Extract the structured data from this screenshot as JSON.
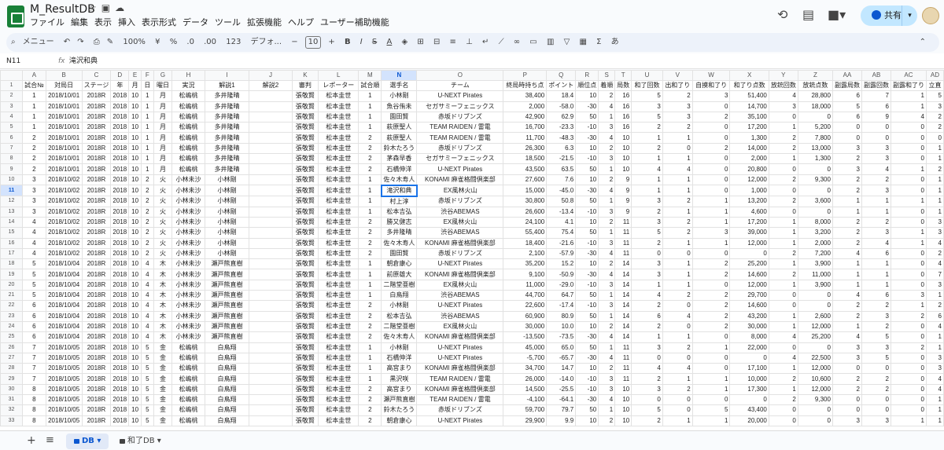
{
  "app": {
    "title": "M_ResultDB",
    "share": "共有"
  },
  "menu": [
    "ファイル",
    "編集",
    "表示",
    "挿入",
    "表示形式",
    "データ",
    "ツール",
    "拡張機能",
    "ヘルプ",
    "ユーザー補助機能"
  ],
  "toolbar": {
    "search": "メニュー",
    "zoom": "100%",
    "yen": "¥",
    "percent": "%",
    "dec_less": ".0",
    "dec_more": ".00",
    "numfmt": "123",
    "font": "デフォ...",
    "font_size": "10",
    "bold": "B",
    "italic": "I",
    "strike": "S",
    "sigma": "Σ",
    "ime": "あ"
  },
  "formula": {
    "cell": "N11",
    "fx": "fx",
    "value": "滝沢和典"
  },
  "columns": [
    "A",
    "B",
    "C",
    "D",
    "E",
    "F",
    "G",
    "H",
    "I",
    "J",
    "K",
    "L",
    "M",
    "N",
    "O",
    "P",
    "Q",
    "R",
    "S",
    "T",
    "U",
    "V",
    "W",
    "X",
    "Y",
    "Z",
    "AA",
    "AB",
    "AC",
    "AD"
  ],
  "headers": [
    "試合№",
    "対局日",
    "ステージ",
    "年",
    "月",
    "日",
    "曜日",
    "実況",
    "解説1",
    "解説2",
    "審判",
    "レポーター",
    "試合順",
    "選手名",
    "チーム",
    "終局時持ち点",
    "ポイント",
    "順位点",
    "着順",
    "局数",
    "和了回数",
    "出和了り",
    "自摸和了り",
    "和了り点数",
    "放銃回数",
    "放銃点数",
    "副露局数",
    "副露回数",
    "副露和了り",
    "立直"
  ],
  "rows": [
    {
      "n": "2",
      "c": [
        "1",
        "2018/10/01",
        "2018R",
        "2018",
        "10",
        "1",
        "月",
        "松嶋桃",
        "多井隆晴",
        "",
        "張敬賢",
        "松本圭世",
        "1",
        "小林剛",
        "U-NEXT Pirates",
        "38,400",
        "18.4",
        "10",
        "2",
        "16",
        "5",
        "2",
        "3",
        "51,400",
        "4",
        "28,800",
        "6",
        "7",
        "1",
        "5"
      ]
    },
    {
      "n": "3",
      "c": [
        "1",
        "2018/10/01",
        "2018R",
        "2018",
        "10",
        "1",
        "月",
        "松嶋桃",
        "多井隆晴",
        "",
        "張敬賢",
        "松本圭世",
        "1",
        "魚谷侑未",
        "セガサミーフェニックス",
        "2,000",
        "-58.0",
        "-30",
        "4",
        "16",
        "3",
        "3",
        "0",
        "14,700",
        "3",
        "18,000",
        "5",
        "6",
        "1",
        "3"
      ]
    },
    {
      "n": "4",
      "c": [
        "1",
        "2018/10/01",
        "2018R",
        "2018",
        "10",
        "1",
        "月",
        "松嶋桃",
        "多井隆晴",
        "",
        "張敬賢",
        "松本圭世",
        "1",
        "園田賢",
        "赤坂ドリブンズ",
        "42,900",
        "62.9",
        "50",
        "1",
        "16",
        "5",
        "3",
        "2",
        "35,100",
        "0",
        "0",
        "6",
        "9",
        "4",
        "2"
      ]
    },
    {
      "n": "5",
      "c": [
        "1",
        "2018/10/01",
        "2018R",
        "2018",
        "10",
        "1",
        "月",
        "松嶋桃",
        "多井隆晴",
        "",
        "張敬賢",
        "松本圭世",
        "1",
        "萩原聖人",
        "TEAM RAIDEN / 雷電",
        "16,700",
        "-23.3",
        "-10",
        "3",
        "16",
        "2",
        "2",
        "0",
        "17,200",
        "1",
        "5,200",
        "0",
        "0",
        "0",
        "2"
      ]
    },
    {
      "n": "6",
      "c": [
        "2",
        "2018/10/01",
        "2018R",
        "2018",
        "10",
        "1",
        "月",
        "松嶋桃",
        "多井隆晴",
        "",
        "張敬賢",
        "松本圭世",
        "2",
        "萩原聖人",
        "TEAM RAIDEN / 雷電",
        "11,700",
        "-48.3",
        "-30",
        "4",
        "10",
        "1",
        "1",
        "0",
        "1,300",
        "2",
        "7,800",
        "0",
        "0",
        "0",
        "0"
      ]
    },
    {
      "n": "7",
      "c": [
        "2",
        "2018/10/01",
        "2018R",
        "2018",
        "10",
        "1",
        "月",
        "松嶋桃",
        "多井隆晴",
        "",
        "張敬賢",
        "松本圭世",
        "2",
        "鈴木たろう",
        "赤坂ドリブンズ",
        "26,300",
        "6.3",
        "10",
        "2",
        "10",
        "2",
        "0",
        "2",
        "14,000",
        "2",
        "13,000",
        "3",
        "3",
        "0",
        "1"
      ]
    },
    {
      "n": "8",
      "c": [
        "2",
        "2018/10/01",
        "2018R",
        "2018",
        "10",
        "1",
        "月",
        "松嶋桃",
        "多井隆晴",
        "",
        "張敬賢",
        "松本圭世",
        "2",
        "茅森早香",
        "セガサミーフェニックス",
        "18,500",
        "-21.5",
        "-10",
        "3",
        "10",
        "1",
        "1",
        "0",
        "2,000",
        "1",
        "1,300",
        "2",
        "3",
        "0",
        "1"
      ]
    },
    {
      "n": "9",
      "c": [
        "2",
        "2018/10/01",
        "2018R",
        "2018",
        "10",
        "1",
        "月",
        "松嶋桃",
        "多井隆晴",
        "",
        "張敬賢",
        "松本圭世",
        "2",
        "石橋伸洋",
        "U-NEXT Pirates",
        "43,500",
        "63.5",
        "50",
        "1",
        "10",
        "4",
        "4",
        "0",
        "20,800",
        "0",
        "0",
        "3",
        "4",
        "1",
        "2"
      ]
    },
    {
      "n": "10",
      "c": [
        "3",
        "2018/10/02",
        "2018R",
        "2018",
        "10",
        "2",
        "火",
        "小林未沙",
        "小林剛",
        "",
        "張敬賢",
        "松本圭世",
        "1",
        "佐々木寿人",
        "KONAMI 麻雀格闘倶楽部",
        "27,600",
        "7.6",
        "10",
        "2",
        "9",
        "1",
        "1",
        "0",
        "12,000",
        "2",
        "9,300",
        "2",
        "2",
        "0",
        "1"
      ]
    },
    {
      "n": "11",
      "c": [
        "3",
        "2018/10/02",
        "2018R",
        "2018",
        "10",
        "2",
        "火",
        "小林未沙",
        "小林剛",
        "",
        "張敬賢",
        "松本圭世",
        "1",
        "滝沢和典",
        "EX風林火山",
        "15,000",
        "-45.0",
        "-30",
        "4",
        "9",
        "1",
        "1",
        "0",
        "1,000",
        "0",
        "0",
        "2",
        "3",
        "0",
        "1"
      ]
    },
    {
      "n": "12",
      "c": [
        "3",
        "2018/10/02",
        "2018R",
        "2018",
        "10",
        "2",
        "火",
        "小林未沙",
        "小林剛",
        "",
        "張敬賢",
        "松本圭世",
        "1",
        "村上淳",
        "赤坂ドリブンズ",
        "30,800",
        "50.8",
        "50",
        "1",
        "9",
        "3",
        "2",
        "1",
        "13,200",
        "2",
        "3,600",
        "1",
        "1",
        "1",
        "1"
      ]
    },
    {
      "n": "13",
      "c": [
        "3",
        "2018/10/02",
        "2018R",
        "2018",
        "10",
        "2",
        "火",
        "小林未沙",
        "小林剛",
        "",
        "張敬賢",
        "松本圭世",
        "1",
        "松本吉弘",
        "渋谷ABEMAS",
        "26,600",
        "-13.4",
        "-10",
        "3",
        "9",
        "2",
        "1",
        "1",
        "4,600",
        "0",
        "0",
        "1",
        "1",
        "0",
        "1"
      ]
    },
    {
      "n": "14",
      "c": [
        "4",
        "2018/10/02",
        "2018R",
        "2018",
        "10",
        "2",
        "火",
        "小林未沙",
        "小林剛",
        "",
        "張敬賢",
        "松本圭世",
        "2",
        "勝又健志",
        "EX風林火山",
        "24,100",
        "4.1",
        "10",
        "2",
        "11",
        "3",
        "2",
        "1",
        "17,200",
        "1",
        "8,000",
        "2",
        "2",
        "0",
        "3"
      ]
    },
    {
      "n": "15",
      "c": [
        "4",
        "2018/10/02",
        "2018R",
        "2018",
        "10",
        "2",
        "火",
        "小林未沙",
        "小林剛",
        "",
        "張敬賢",
        "松本圭世",
        "2",
        "多井隆晴",
        "渋谷ABEMAS",
        "55,400",
        "75.4",
        "50",
        "1",
        "11",
        "5",
        "2",
        "3",
        "39,000",
        "1",
        "3,200",
        "2",
        "3",
        "1",
        "3"
      ]
    },
    {
      "n": "16",
      "c": [
        "4",
        "2018/10/02",
        "2018R",
        "2018",
        "10",
        "2",
        "火",
        "小林未沙",
        "小林剛",
        "",
        "張敬賢",
        "松本圭世",
        "2",
        "佐々木寿人",
        "KONAMI 麻雀格闘倶楽部",
        "18,400",
        "-21.6",
        "-10",
        "3",
        "11",
        "2",
        "1",
        "1",
        "12,000",
        "1",
        "2,000",
        "2",
        "4",
        "1",
        "4"
      ]
    },
    {
      "n": "17",
      "c": [
        "4",
        "2018/10/02",
        "2018R",
        "2018",
        "10",
        "2",
        "火",
        "小林未沙",
        "小林剛",
        "",
        "張敬賢",
        "松本圭世",
        "2",
        "園田賢",
        "赤坂ドリブンズ",
        "2,100",
        "-57.9",
        "-30",
        "4",
        "11",
        "0",
        "0",
        "0",
        "0",
        "2",
        "7,200",
        "4",
        "6",
        "0",
        "2"
      ]
    },
    {
      "n": "18",
      "c": [
        "5",
        "2018/10/04",
        "2018R",
        "2018",
        "10",
        "4",
        "木",
        "小林未沙",
        "瀬戸熊直樹",
        "",
        "張敬賢",
        "松本圭世",
        "1",
        "朝倉康心",
        "U-NEXT Pirates",
        "35,200",
        "15.2",
        "10",
        "2",
        "14",
        "3",
        "1",
        "2",
        "25,200",
        "1",
        "3,900",
        "1",
        "1",
        "0",
        "4"
      ]
    },
    {
      "n": "19",
      "c": [
        "5",
        "2018/10/04",
        "2018R",
        "2018",
        "10",
        "4",
        "木",
        "小林未沙",
        "瀬戸熊直樹",
        "",
        "張敬賢",
        "松本圭世",
        "1",
        "前原雄大",
        "KONAMI 麻雀格闘倶楽部",
        "9,100",
        "-50.9",
        "-30",
        "4",
        "14",
        "3",
        "1",
        "2",
        "14,600",
        "2",
        "11,000",
        "1",
        "1",
        "0",
        "7"
      ]
    },
    {
      "n": "20",
      "c": [
        "5",
        "2018/10/04",
        "2018R",
        "2018",
        "10",
        "4",
        "木",
        "小林未沙",
        "瀬戸熊直樹",
        "",
        "張敬賢",
        "松本圭世",
        "1",
        "二階堂亜樹",
        "EX風林火山",
        "11,000",
        "-29.0",
        "-10",
        "3",
        "14",
        "1",
        "1",
        "0",
        "12,000",
        "1",
        "3,900",
        "1",
        "1",
        "0",
        "3"
      ]
    },
    {
      "n": "21",
      "c": [
        "5",
        "2018/10/04",
        "2018R",
        "2018",
        "10",
        "4",
        "木",
        "小林未沙",
        "瀬戸熊直樹",
        "",
        "張敬賢",
        "松本圭世",
        "1",
        "白鳥翔",
        "渋谷ABEMAS",
        "44,700",
        "64.7",
        "50",
        "1",
        "14",
        "4",
        "2",
        "2",
        "29,700",
        "0",
        "0",
        "4",
        "6",
        "3",
        "1"
      ]
    },
    {
      "n": "22",
      "c": [
        "6",
        "2018/10/04",
        "2018R",
        "2018",
        "10",
        "4",
        "木",
        "小林未沙",
        "瀬戸熊直樹",
        "",
        "張敬賢",
        "松本圭世",
        "2",
        "小林剛",
        "U-NEXT Pirates",
        "22,600",
        "-17.4",
        "-10",
        "3",
        "14",
        "2",
        "0",
        "2",
        "14,600",
        "0",
        "0",
        "2",
        "2",
        "1",
        "2"
      ]
    },
    {
      "n": "23",
      "c": [
        "6",
        "2018/10/04",
        "2018R",
        "2018",
        "10",
        "4",
        "木",
        "小林未沙",
        "瀬戸熊直樹",
        "",
        "張敬賢",
        "松本圭世",
        "2",
        "松本吉弘",
        "渋谷ABEMAS",
        "60,900",
        "80.9",
        "50",
        "1",
        "14",
        "6",
        "4",
        "2",
        "43,200",
        "1",
        "2,600",
        "2",
        "3",
        "2",
        "6"
      ]
    },
    {
      "n": "24",
      "c": [
        "6",
        "2018/10/04",
        "2018R",
        "2018",
        "10",
        "4",
        "木",
        "小林未沙",
        "瀬戸熊直樹",
        "",
        "張敬賢",
        "松本圭世",
        "2",
        "二階堂亜樹",
        "EX風林火山",
        "30,000",
        "10.0",
        "10",
        "2",
        "14",
        "2",
        "0",
        "2",
        "30,000",
        "1",
        "12,000",
        "1",
        "2",
        "0",
        "4"
      ]
    },
    {
      "n": "25",
      "c": [
        "6",
        "2018/10/04",
        "2018R",
        "2018",
        "10",
        "4",
        "木",
        "小林未沙",
        "瀬戸熊直樹",
        "",
        "張敬賢",
        "松本圭世",
        "2",
        "佐々木寿人",
        "KONAMI 麻雀格闘倶楽部",
        "-13,500",
        "-73.5",
        "-30",
        "4",
        "14",
        "1",
        "1",
        "0",
        "8,000",
        "4",
        "25,200",
        "4",
        "5",
        "0",
        "1"
      ]
    },
    {
      "n": "26",
      "c": [
        "7",
        "2018/10/05",
        "2018R",
        "2018",
        "10",
        "5",
        "金",
        "松嶋桃",
        "白鳥翔",
        "",
        "張敬賢",
        "松本圭世",
        "1",
        "小林剛",
        "U-NEXT Pirates",
        "45,000",
        "65.0",
        "50",
        "1",
        "11",
        "3",
        "2",
        "1",
        "22,000",
        "0",
        "0",
        "3",
        "3",
        "2",
        "1"
      ]
    },
    {
      "n": "27",
      "c": [
        "7",
        "2018/10/05",
        "2018R",
        "2018",
        "10",
        "5",
        "金",
        "松嶋桃",
        "白鳥翔",
        "",
        "張敬賢",
        "松本圭世",
        "1",
        "石橋伸洋",
        "U-NEXT Pirates",
        "-5,700",
        "-65.7",
        "-30",
        "4",
        "11",
        "0",
        "0",
        "0",
        "0",
        "4",
        "22,500",
        "3",
        "5",
        "0",
        "3"
      ]
    },
    {
      "n": "28",
      "c": [
        "7",
        "2018/10/05",
        "2018R",
        "2018",
        "10",
        "5",
        "金",
        "松嶋桃",
        "白鳥翔",
        "",
        "張敬賢",
        "松本圭世",
        "1",
        "高宮まり",
        "KONAMI 麻雀格闘倶楽部",
        "34,700",
        "14.7",
        "10",
        "2",
        "11",
        "4",
        "4",
        "0",
        "17,100",
        "1",
        "12,000",
        "0",
        "0",
        "0",
        "3"
      ]
    },
    {
      "n": "29",
      "c": [
        "7",
        "2018/10/05",
        "2018R",
        "2018",
        "10",
        "5",
        "金",
        "松嶋桃",
        "白鳥翔",
        "",
        "張敬賢",
        "松本圭世",
        "1",
        "黒沢咲",
        "TEAM RAIDEN / 雷電",
        "26,000",
        "-14.0",
        "-10",
        "3",
        "11",
        "2",
        "1",
        "1",
        "10,000",
        "2",
        "10,600",
        "2",
        "2",
        "0",
        "4"
      ]
    },
    {
      "n": "30",
      "c": [
        "8",
        "2018/10/05",
        "2018R",
        "2018",
        "10",
        "5",
        "金",
        "松嶋桃",
        "白鳥翔",
        "",
        "張敬賢",
        "松本圭世",
        "2",
        "高宮まり",
        "KONAMI 麻雀格闘倶楽部",
        "14,500",
        "-25.5",
        "-10",
        "3",
        "10",
        "3",
        "2",
        "1",
        "17,300",
        "1",
        "12,000",
        "2",
        "2",
        "0",
        "4"
      ]
    },
    {
      "n": "31",
      "c": [
        "8",
        "2018/10/05",
        "2018R",
        "2018",
        "10",
        "5",
        "金",
        "松嶋桃",
        "白鳥翔",
        "",
        "張敬賢",
        "松本圭世",
        "2",
        "瀬戸熊直樹",
        "TEAM RAIDEN / 雷電",
        "-4,100",
        "-64.1",
        "-30",
        "4",
        "10",
        "0",
        "0",
        "0",
        "0",
        "2",
        "9,300",
        "0",
        "0",
        "0",
        "1"
      ]
    },
    {
      "n": "32",
      "c": [
        "8",
        "2018/10/05",
        "2018R",
        "2018",
        "10",
        "5",
        "金",
        "松嶋桃",
        "白鳥翔",
        "",
        "張敬賢",
        "松本圭世",
        "2",
        "鈴木たろう",
        "赤坂ドリブンズ",
        "59,700",
        "79.7",
        "50",
        "1",
        "10",
        "5",
        "0",
        "5",
        "43,400",
        "0",
        "0",
        "0",
        "0",
        "0",
        "1"
      ]
    },
    {
      "n": "33",
      "c": [
        "8",
        "2018/10/05",
        "2018R",
        "2018",
        "10",
        "5",
        "金",
        "松嶋桃",
        "白鳥翔",
        "",
        "張敬賢",
        "松本圭世",
        "2",
        "朝倉康心",
        "U-NEXT Pirates",
        "29,900",
        "9.9",
        "10",
        "2",
        "10",
        "2",
        "1",
        "1",
        "20,000",
        "0",
        "0",
        "3",
        "3",
        "1",
        "1"
      ]
    }
  ],
  "sheets": {
    "active": "DB",
    "other": "和了DB"
  }
}
